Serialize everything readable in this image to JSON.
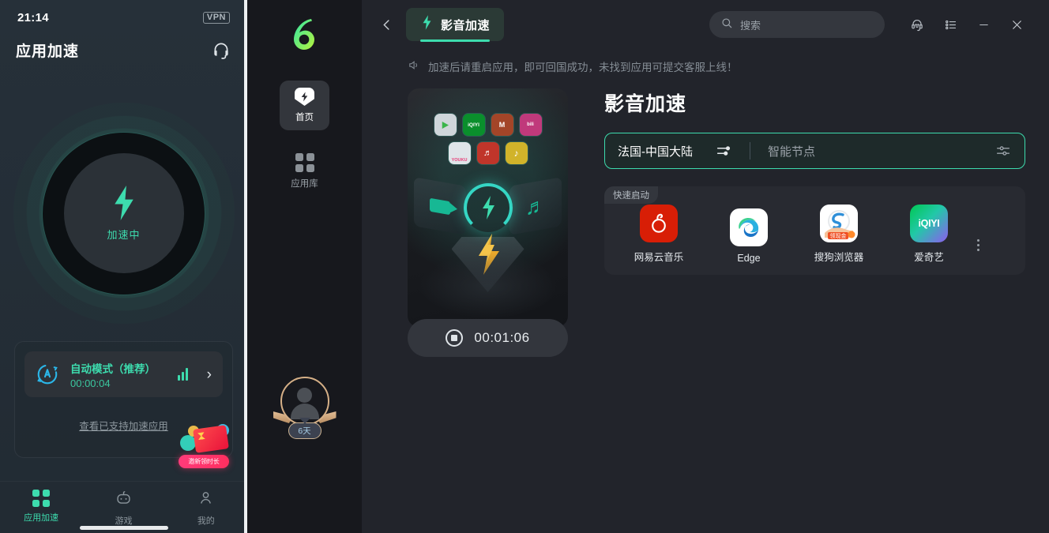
{
  "phone": {
    "status": {
      "time": "21:14",
      "vpn": "VPN"
    },
    "header": {
      "title": "应用加速",
      "support_icon": "headset-icon"
    },
    "ring": {
      "label": "加速中",
      "icon": "bolt-icon"
    },
    "mode_card": {
      "icon": "auto-mode-icon",
      "name": "自动模式（推荐）",
      "elapsed": "00:00:04",
      "signal_icon": "signal-bars-icon",
      "chevron": "›"
    },
    "supported_link": "查看已支持加速应用",
    "promo": {
      "label": "邀新领时长"
    },
    "tabs": [
      {
        "label": "应用加速",
        "icon": "grid-icon",
        "active": true
      },
      {
        "label": "游戏",
        "icon": "gamepad-icon",
        "active": false
      },
      {
        "label": "我的",
        "icon": "person-icon",
        "active": false
      }
    ]
  },
  "nav": {
    "logo": "brand-6-logo",
    "items": [
      {
        "label": "首页",
        "icon": "bolt-home-icon",
        "active": true
      },
      {
        "label": "应用库",
        "icon": "grid-apps-icon",
        "active": false
      }
    ],
    "avatar": {
      "icon": "person-avatar-icon",
      "vip_days": "6天"
    }
  },
  "titlebar": {
    "back_icon": "chevron-left-icon",
    "mode_tab": {
      "label": "影音加速",
      "icon": "bolt-icon"
    },
    "search": {
      "placeholder": "搜索",
      "value": "",
      "icon": "search-icon"
    },
    "actions": [
      {
        "name": "customer-service-button",
        "icon": "headset-icon"
      },
      {
        "name": "menu-list-button",
        "icon": "list-icon"
      },
      {
        "name": "minimize-button",
        "icon": "minimize-icon"
      },
      {
        "name": "close-button",
        "icon": "close-icon"
      }
    ]
  },
  "notice": {
    "icon": "speaker-icon",
    "text": "加速后请重启应用，即可回国成功，未找到应用可提交客服上线！"
  },
  "main": {
    "page_title": "影音加速",
    "region_bar": {
      "region": "法国-中国大陆",
      "region_icon": "sliders-icon",
      "node": "智能节点",
      "node_icon": "sliders-settings-icon"
    },
    "quick_launch": {
      "tag": "快速启动",
      "more_icon": "more-vertical-icon",
      "apps": [
        {
          "name": "网易云音乐",
          "icon": "netease-music-icon",
          "color": "#d81e06"
        },
        {
          "name": "Edge",
          "icon": "edge-icon",
          "color": "#ffffff"
        },
        {
          "name": "搜狗浏览器",
          "icon": "sogou-browser-icon",
          "color": "#ffffff"
        },
        {
          "name": "爱奇艺",
          "icon": "iqiyi-icon",
          "color": "#00be06"
        }
      ]
    },
    "stop_bar": {
      "icon": "stop-icon",
      "time": "00:01:06"
    },
    "illustration": {
      "apps_row1": [
        "Youtube",
        "iQIYI",
        "Mango",
        "bilibili"
      ],
      "apps_row2": [
        "YOUKU",
        "NetEase",
        "QQ Music"
      ],
      "center_icon": "bolt-circle-icon",
      "left_icon": "video-camera-icon",
      "right_icon": "music-note-icon"
    }
  },
  "colors": {
    "accent": "#3ddcae",
    "panel_bg": "#22242b",
    "nav_bg": "#17181d",
    "phone_bg": "#263039"
  }
}
